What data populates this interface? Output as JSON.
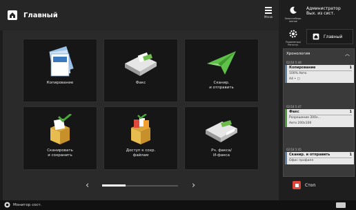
{
  "header": {
    "title": "Главный"
  },
  "menu": {
    "label": "Меню"
  },
  "right_panel": {
    "energy_label": "Энергосбере-жение",
    "admin_line1": "Администратор",
    "admin_line2": "Вых. из сист.",
    "settings_label": "Параметры/ Регистр.",
    "home_label": "Главный",
    "stop_label": "Стоп"
  },
  "tiles": [
    {
      "label": "Копирование"
    },
    {
      "label": "Факс"
    },
    {
      "label": "Сканир.\nи отправить"
    },
    {
      "label": "Сканировать\nи сохранить"
    },
    {
      "label": "Доступ к сохр.\nфайлам"
    },
    {
      "label": "Рч. факса/\nИ-факса"
    }
  ],
  "history": {
    "title": "Хронология",
    "jobs": [
      {
        "time": "02/18 5:48",
        "title": "Копирование",
        "count": "1",
        "row1": "100%   Авто",
        "row2": "A4 • ▢",
        "type": "copy"
      },
      {
        "time": "02/18 5:47",
        "title": "Факс",
        "count": "1",
        "row1": "Разрешение 200x...",
        "row2": "Авто   200x100",
        "type": "fax"
      },
      {
        "time": "02/18 5:45",
        "title": "Сканир. и отправить",
        "count": "1",
        "row1": "Офис профиля",
        "row2": "",
        "type": "scan"
      }
    ]
  },
  "status_bar": {
    "monitor_label": "Монитор сост."
  },
  "colors": {
    "accent_copy": "#5a7fa0",
    "accent_fax": "#4a9a3a",
    "stop": "#e0443a"
  }
}
